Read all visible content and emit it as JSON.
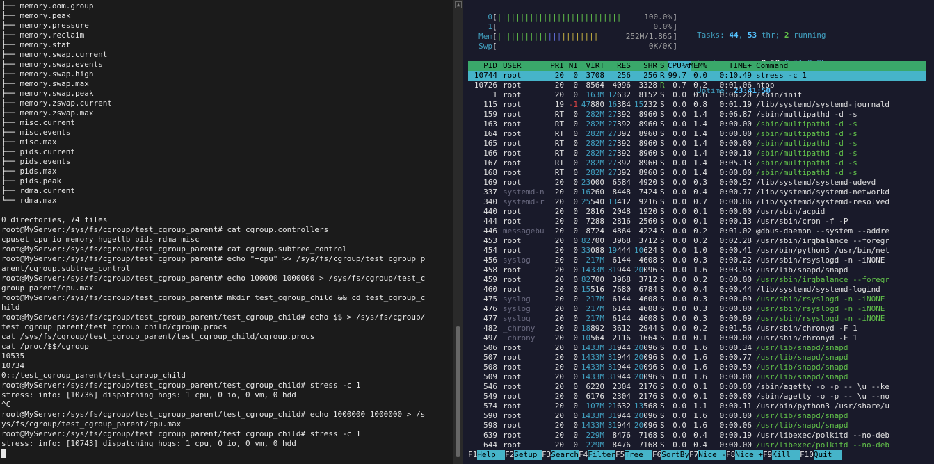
{
  "left_terminal": {
    "lines": [
      "├── memory.oom.group",
      "├── memory.peak",
      "├── memory.pressure",
      "├── memory.reclaim",
      "├── memory.stat",
      "├── memory.swap.current",
      "├── memory.swap.events",
      "├── memory.swap.high",
      "├── memory.swap.max",
      "├── memory.swap.peak",
      "├── memory.zswap.current",
      "├── memory.zswap.max",
      "├── misc.current",
      "├── misc.events",
      "├── misc.max",
      "├── pids.current",
      "├── pids.events",
      "├── pids.max",
      "├── pids.peak",
      "├── rdma.current",
      "└── rdma.max",
      "",
      "0 directories, 74 files",
      "root@MyServer:/sys/fs/cgroup/test_cgroup_parent# cat cgroup.controllers",
      "cpuset cpu io memory hugetlb pids rdma misc",
      "root@MyServer:/sys/fs/cgroup/test_cgroup_parent# cat cgroup.subtree_control",
      "root@MyServer:/sys/fs/cgroup/test_cgroup_parent# echo \"+cpu\" >> /sys/fs/cgroup/test_cgroup_p",
      "arent/cgroup.subtree_control",
      "root@MyServer:/sys/fs/cgroup/test_cgroup_parent# echo 100000 1000000 > /sys/fs/cgroup/test_c",
      "group_parent/cpu.max",
      "root@MyServer:/sys/fs/cgroup/test_cgroup_parent# mkdir test_cgroup_child && cd test_cgroup_c",
      "hild",
      "root@MyServer:/sys/fs/cgroup/test_cgroup_parent/test_cgroup_child# echo $$ > /sys/fs/cgroup/",
      "test_cgroup_parent/test_cgroup_child/cgroup.procs",
      "cat /sys/fs/cgroup/test_cgroup_parent/test_cgroup_child/cgroup.procs",
      "cat /proc/$$/cgroup",
      "10535",
      "10734",
      "0::/test_cgroup_parent/test_cgroup_child",
      "root@MyServer:/sys/fs/cgroup/test_cgroup_parent/test_cgroup_child# stress -c 1",
      "stress: info: [10736] dispatching hogs: 1 cpu, 0 io, 0 vm, 0 hdd",
      "^C",
      "root@MyServer:/sys/fs/cgroup/test_cgroup_parent/test_cgroup_child# echo 1000000 1000000 > /s",
      "ys/fs/cgroup/test_cgroup_parent/cpu.max",
      "root@MyServer:/sys/fs/cgroup/test_cgroup_parent/test_cgroup_child# stress -c 1",
      "stress: info: [10743] dispatching hogs: 1 cpu, 0 io, 0 vm, 0 hdd"
    ]
  },
  "htop": {
    "meters": [
      {
        "label": "0",
        "bar": "|||||||||||||||||||||||||||",
        "value": "100.0%",
        "fraction": 1.0
      },
      {
        "label": "1",
        "bar": "",
        "value": "0.0%",
        "fraction": 0.0
      },
      {
        "label": "Mem",
        "bar": "||||||||||||||||||||||",
        "value": "252M/1.86G",
        "fraction": 0.135
      },
      {
        "label": "Swp",
        "bar": "",
        "value": "0K/0K",
        "fraction": 0.0
      }
    ],
    "tasks_label": "Tasks: ",
    "tasks_count": "44",
    "tasks_sep": ", ",
    "threads_count": "53",
    "threads_label": " thr; ",
    "running_count": "2",
    "running_label": " running",
    "load_label": "Load average: ",
    "load_1": "0.18",
    "load_5": "0.11",
    "load_15": "0.05",
    "uptime_label": "Uptime: ",
    "uptime_value": "23:41:50",
    "columns": [
      "PID",
      "USER",
      "PRI",
      "NI",
      "VIRT",
      "RES",
      "SHR",
      "S",
      "CPU%▽",
      "MEM%",
      "TIME+",
      "Command"
    ],
    "processes": [
      {
        "pid": "10744",
        "user": "root",
        "pri": "20",
        "ni": "0",
        "virt": "3708",
        "res": "256",
        "shr": "256",
        "s": "R",
        "cpu": "99.7",
        "mem": "0.0",
        "time": "0:10.49",
        "cmd": "stress -c 1",
        "selected": true
      },
      {
        "pid": "10726",
        "user": "root",
        "pri": "20",
        "ni": "0",
        "virt": "8564",
        "res": "4096",
        "shr": "3328",
        "s": "R",
        "cpu": "0.7",
        "mem": "0.2",
        "time": "0:01.06",
        "cmd": "htop"
      },
      {
        "pid": "1",
        "user": "root",
        "pri": "20",
        "ni": "0",
        "virt": "163M",
        "res": "12632",
        "shr": "8152",
        "s": "S",
        "cpu": "0.0",
        "mem": "0.6",
        "time": "0:06.20",
        "cmd": "/sbin/init"
      },
      {
        "pid": "115",
        "user": "root",
        "pri": "19",
        "ni": "-1",
        "virt": "47880",
        "res": "16384",
        "shr": "15232",
        "s": "S",
        "cpu": "0.0",
        "mem": "0.8",
        "time": "0:01.19",
        "cmd": "/lib/systemd/systemd-journald"
      },
      {
        "pid": "159",
        "user": "root",
        "pri": "RT",
        "ni": "0",
        "virt": "282M",
        "res": "27392",
        "shr": "8960",
        "s": "S",
        "cpu": "0.0",
        "mem": "1.4",
        "time": "0:06.87",
        "cmd": "/sbin/multipathd -d -s"
      },
      {
        "pid": "163",
        "user": "root",
        "pri": "RT",
        "ni": "0",
        "virt": "282M",
        "res": "27392",
        "shr": "8960",
        "s": "S",
        "cpu": "0.0",
        "mem": "1.4",
        "time": "0:00.00",
        "cmd": "/sbin/multipathd -d -s",
        "thread": true
      },
      {
        "pid": "164",
        "user": "root",
        "pri": "RT",
        "ni": "0",
        "virt": "282M",
        "res": "27392",
        "shr": "8960",
        "s": "S",
        "cpu": "0.0",
        "mem": "1.4",
        "time": "0:00.00",
        "cmd": "/sbin/multipathd -d -s",
        "thread": true
      },
      {
        "pid": "165",
        "user": "root",
        "pri": "RT",
        "ni": "0",
        "virt": "282M",
        "res": "27392",
        "shr": "8960",
        "s": "S",
        "cpu": "0.0",
        "mem": "1.4",
        "time": "0:00.00",
        "cmd": "/sbin/multipathd -d -s",
        "thread": true
      },
      {
        "pid": "166",
        "user": "root",
        "pri": "RT",
        "ni": "0",
        "virt": "282M",
        "res": "27392",
        "shr": "8960",
        "s": "S",
        "cpu": "0.0",
        "mem": "1.4",
        "time": "0:00.10",
        "cmd": "/sbin/multipathd -d -s",
        "thread": true
      },
      {
        "pid": "167",
        "user": "root",
        "pri": "RT",
        "ni": "0",
        "virt": "282M",
        "res": "27392",
        "shr": "8960",
        "s": "S",
        "cpu": "0.0",
        "mem": "1.4",
        "time": "0:05.13",
        "cmd": "/sbin/multipathd -d -s",
        "thread": true
      },
      {
        "pid": "168",
        "user": "root",
        "pri": "RT",
        "ni": "0",
        "virt": "282M",
        "res": "27392",
        "shr": "8960",
        "s": "S",
        "cpu": "0.0",
        "mem": "1.4",
        "time": "0:00.00",
        "cmd": "/sbin/multipathd -d -s",
        "thread": true
      },
      {
        "pid": "169",
        "user": "root",
        "pri": "20",
        "ni": "0",
        "virt": "23000",
        "res": "6584",
        "shr": "4920",
        "s": "S",
        "cpu": "0.0",
        "mem": "0.3",
        "time": "0:00.57",
        "cmd": "/lib/systemd/systemd-udevd"
      },
      {
        "pid": "337",
        "user": "systemd-n",
        "pri": "20",
        "ni": "0",
        "virt": "16260",
        "res": "8448",
        "shr": "7424",
        "s": "S",
        "cpu": "0.0",
        "mem": "0.4",
        "time": "0:00.77",
        "cmd": "/lib/systemd/systemd-networkd"
      },
      {
        "pid": "340",
        "user": "systemd-r",
        "pri": "20",
        "ni": "0",
        "virt": "25540",
        "res": "13412",
        "shr": "9216",
        "s": "S",
        "cpu": "0.0",
        "mem": "0.7",
        "time": "0:00.86",
        "cmd": "/lib/systemd/systemd-resolved"
      },
      {
        "pid": "440",
        "user": "root",
        "pri": "20",
        "ni": "0",
        "virt": "2816",
        "res": "2048",
        "shr": "1920",
        "s": "S",
        "cpu": "0.0",
        "mem": "0.1",
        "time": "0:00.00",
        "cmd": "/usr/sbin/acpid"
      },
      {
        "pid": "444",
        "user": "root",
        "pri": "20",
        "ni": "0",
        "virt": "7288",
        "res": "2816",
        "shr": "2560",
        "s": "S",
        "cpu": "0.0",
        "mem": "0.1",
        "time": "0:00.13",
        "cmd": "/usr/sbin/cron -f -P"
      },
      {
        "pid": "446",
        "user": "messagebu",
        "pri": "20",
        "ni": "0",
        "virt": "8724",
        "res": "4864",
        "shr": "4224",
        "s": "S",
        "cpu": "0.0",
        "mem": "0.2",
        "time": "0:01.02",
        "cmd": "@dbus-daemon --system --addre"
      },
      {
        "pid": "453",
        "user": "root",
        "pri": "20",
        "ni": "0",
        "virt": "82700",
        "res": "3968",
        "shr": "3712",
        "s": "S",
        "cpu": "0.0",
        "mem": "0.2",
        "time": "0:02.28",
        "cmd": "/usr/sbin/irqbalance --foregr"
      },
      {
        "pid": "454",
        "user": "root",
        "pri": "20",
        "ni": "0",
        "virt": "33088",
        "res": "19444",
        "shr": "10624",
        "s": "S",
        "cpu": "0.0",
        "mem": "1.0",
        "time": "0:00.41",
        "cmd": "/usr/bin/python3 /usr/bin/net"
      },
      {
        "pid": "456",
        "user": "syslog",
        "pri": "20",
        "ni": "0",
        "virt": "217M",
        "res": "6144",
        "shr": "4608",
        "s": "S",
        "cpu": "0.0",
        "mem": "0.3",
        "time": "0:00.22",
        "cmd": "/usr/sbin/rsyslogd -n -iNONE"
      },
      {
        "pid": "458",
        "user": "root",
        "pri": "20",
        "ni": "0",
        "virt": "1433M",
        "res": "31944",
        "shr": "20096",
        "s": "S",
        "cpu": "0.0",
        "mem": "1.6",
        "time": "0:03.93",
        "cmd": "/usr/lib/snapd/snapd"
      },
      {
        "pid": "459",
        "user": "root",
        "pri": "20",
        "ni": "0",
        "virt": "82700",
        "res": "3968",
        "shr": "3712",
        "s": "S",
        "cpu": "0.0",
        "mem": "0.2",
        "time": "0:00.00",
        "cmd": "/usr/sbin/irqbalance --foregr",
        "thread": true
      },
      {
        "pid": "460",
        "user": "root",
        "pri": "20",
        "ni": "0",
        "virt": "15516",
        "res": "7680",
        "shr": "6784",
        "s": "S",
        "cpu": "0.0",
        "mem": "0.4",
        "time": "0:00.44",
        "cmd": "/lib/systemd/systemd-logind"
      },
      {
        "pid": "475",
        "user": "syslog",
        "pri": "20",
        "ni": "0",
        "virt": "217M",
        "res": "6144",
        "shr": "4608",
        "s": "S",
        "cpu": "0.0",
        "mem": "0.3",
        "time": "0:00.09",
        "cmd": "/usr/sbin/rsyslogd -n -iNONE",
        "thread": true
      },
      {
        "pid": "476",
        "user": "syslog",
        "pri": "20",
        "ni": "0",
        "virt": "217M",
        "res": "6144",
        "shr": "4608",
        "s": "S",
        "cpu": "0.0",
        "mem": "0.3",
        "time": "0:00.00",
        "cmd": "/usr/sbin/rsyslogd -n -iNONE",
        "thread": true
      },
      {
        "pid": "477",
        "user": "syslog",
        "pri": "20",
        "ni": "0",
        "virt": "217M",
        "res": "6144",
        "shr": "4608",
        "s": "S",
        "cpu": "0.0",
        "mem": "0.3",
        "time": "0:00.09",
        "cmd": "/usr/sbin/rsyslogd -n -iNONE",
        "thread": true
      },
      {
        "pid": "482",
        "user": "_chrony",
        "pri": "20",
        "ni": "0",
        "virt": "18892",
        "res": "3612",
        "shr": "2944",
        "s": "S",
        "cpu": "0.0",
        "mem": "0.2",
        "time": "0:01.56",
        "cmd": "/usr/sbin/chronyd -F 1"
      },
      {
        "pid": "497",
        "user": "_chrony",
        "pri": "20",
        "ni": "0",
        "virt": "10564",
        "res": "2116",
        "shr": "1664",
        "s": "S",
        "cpu": "0.0",
        "mem": "0.1",
        "time": "0:00.00",
        "cmd": "/usr/sbin/chronyd -F 1"
      },
      {
        "pid": "506",
        "user": "root",
        "pri": "20",
        "ni": "0",
        "virt": "1433M",
        "res": "31944",
        "shr": "20096",
        "s": "S",
        "cpu": "0.0",
        "mem": "1.6",
        "time": "0:00.34",
        "cmd": "/usr/lib/snapd/snapd",
        "thread": true
      },
      {
        "pid": "507",
        "user": "root",
        "pri": "20",
        "ni": "0",
        "virt": "1433M",
        "res": "31944",
        "shr": "20096",
        "s": "S",
        "cpu": "0.0",
        "mem": "1.6",
        "time": "0:00.77",
        "cmd": "/usr/lib/snapd/snapd",
        "thread": true
      },
      {
        "pid": "508",
        "user": "root",
        "pri": "20",
        "ni": "0",
        "virt": "1433M",
        "res": "31944",
        "shr": "20096",
        "s": "S",
        "cpu": "0.0",
        "mem": "1.6",
        "time": "0:00.59",
        "cmd": "/usr/lib/snapd/snapd",
        "thread": true
      },
      {
        "pid": "509",
        "user": "root",
        "pri": "20",
        "ni": "0",
        "virt": "1433M",
        "res": "31944",
        "shr": "20096",
        "s": "S",
        "cpu": "0.0",
        "mem": "1.6",
        "time": "0:00.00",
        "cmd": "/usr/lib/snapd/snapd",
        "thread": true
      },
      {
        "pid": "546",
        "user": "root",
        "pri": "20",
        "ni": "0",
        "virt": "6220",
        "res": "2304",
        "shr": "2176",
        "s": "S",
        "cpu": "0.0",
        "mem": "0.1",
        "time": "0:00.00",
        "cmd": "/sbin/agetty -o -p -- \\u --ke"
      },
      {
        "pid": "549",
        "user": "root",
        "pri": "20",
        "ni": "0",
        "virt": "6176",
        "res": "2304",
        "shr": "2176",
        "s": "S",
        "cpu": "0.0",
        "mem": "0.1",
        "time": "0:00.00",
        "cmd": "/sbin/agetty -o -p -- \\u --no"
      },
      {
        "pid": "574",
        "user": "root",
        "pri": "20",
        "ni": "0",
        "virt": "107M",
        "res": "21632",
        "shr": "13568",
        "s": "S",
        "cpu": "0.0",
        "mem": "1.1",
        "time": "0:00.11",
        "cmd": "/usr/bin/python3 /usr/share/u"
      },
      {
        "pid": "590",
        "user": "root",
        "pri": "20",
        "ni": "0",
        "virt": "1433M",
        "res": "31944",
        "shr": "20096",
        "s": "S",
        "cpu": "0.0",
        "mem": "1.6",
        "time": "0:00.00",
        "cmd": "/usr/lib/snapd/snapd",
        "thread": true
      },
      {
        "pid": "598",
        "user": "root",
        "pri": "20",
        "ni": "0",
        "virt": "1433M",
        "res": "31944",
        "shr": "20096",
        "s": "S",
        "cpu": "0.0",
        "mem": "1.6",
        "time": "0:00.06",
        "cmd": "/usr/lib/snapd/snapd",
        "thread": true
      },
      {
        "pid": "639",
        "user": "root",
        "pri": "20",
        "ni": "0",
        "virt": "229M",
        "res": "8476",
        "shr": "7168",
        "s": "S",
        "cpu": "0.0",
        "mem": "0.4",
        "time": "0:00.19",
        "cmd": "/usr/libexec/polkitd --no-deb"
      },
      {
        "pid": "644",
        "user": "root",
        "pri": "20",
        "ni": "0",
        "virt": "229M",
        "res": "8476",
        "shr": "7168",
        "s": "S",
        "cpu": "0.0",
        "mem": "0.4",
        "time": "0:00.00",
        "cmd": "/usr/libexec/polkitd --no-deb",
        "thread": true
      }
    ],
    "function_keys": [
      {
        "key": "F1",
        "label": "Help  "
      },
      {
        "key": "F2",
        "label": "Setup "
      },
      {
        "key": "F3",
        "label": "Search"
      },
      {
        "key": "F4",
        "label": "Filter"
      },
      {
        "key": "F5",
        "label": "Tree  "
      },
      {
        "key": "F6",
        "label": "SortBy"
      },
      {
        "key": "F7",
        "label": "Nice -"
      },
      {
        "key": "F8",
        "label": "Nice +"
      },
      {
        "key": "F9",
        "label": "Kill  "
      },
      {
        "key": "F10",
        "label": "Quit  "
      }
    ],
    "colors": {
      "background": "#191a2a",
      "header_bar": "#3aa86a",
      "selected_row": "#46b4c9",
      "label_cyan": "#41a0c0",
      "bar_green": "#62c24a"
    }
  }
}
